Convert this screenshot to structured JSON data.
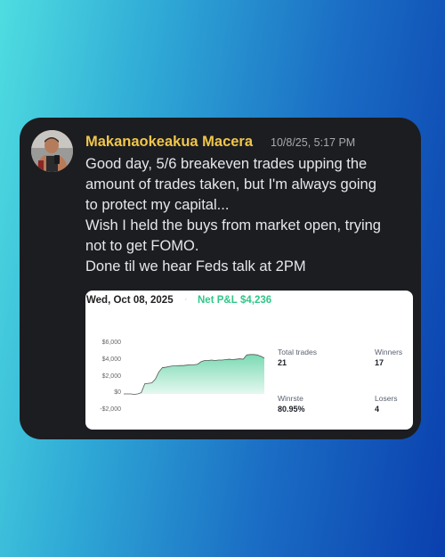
{
  "post": {
    "username": "Makanaokeakua Macera",
    "timestamp": "10/8/25, 5:17 PM",
    "lines": [
      "Good day, 5/6 breakeven trades upping the",
      "amount of trades taken, but I'm always going",
      "to protect my capital...",
      "Wish I held the buys from market open, trying",
      "not to get FOMO.",
      "Done til we hear Feds talk at 2PM"
    ]
  },
  "attachment": {
    "date": "Wed, Oct 08, 2025",
    "separator": "·",
    "net_pnl_label": "Net P&L",
    "net_pnl_value": "$4,236",
    "yticks": [
      "$6,000",
      "$4,000",
      "$2,000",
      "$0",
      "-$2,000"
    ],
    "stats": {
      "total_trades_label": "Total trades",
      "total_trades_value": "21",
      "winners_label": "Winners",
      "winners_value": "17",
      "winrate_label": "Winrste",
      "winrate_value": "80.95%",
      "losers_label": "Losers",
      "losers_value": "4"
    },
    "accent_color": "#33c68a"
  },
  "chart_data": {
    "type": "area",
    "ylim": [
      -2000,
      6000
    ],
    "x": [
      0,
      1,
      2,
      3,
      4,
      5,
      6,
      7,
      8,
      9,
      10,
      11,
      12,
      13,
      14,
      15,
      16,
      17,
      18,
      19,
      20,
      21,
      22,
      23,
      24,
      25,
      26,
      27,
      28,
      29,
      30,
      31,
      32,
      33,
      34,
      35,
      36,
      37,
      38,
      39,
      40
    ],
    "values": [
      0,
      0,
      0,
      -50,
      0,
      150,
      1200,
      1250,
      1300,
      1750,
      2600,
      3100,
      3150,
      3250,
      3300,
      3300,
      3350,
      3350,
      3400,
      3450,
      3450,
      3500,
      3800,
      3950,
      3950,
      4000,
      3950,
      4000,
      4000,
      4050,
      4100,
      4050,
      4100,
      4150,
      4100,
      4600,
      4650,
      4650,
      4600,
      4450,
      4236
    ],
    "grid": false
  }
}
